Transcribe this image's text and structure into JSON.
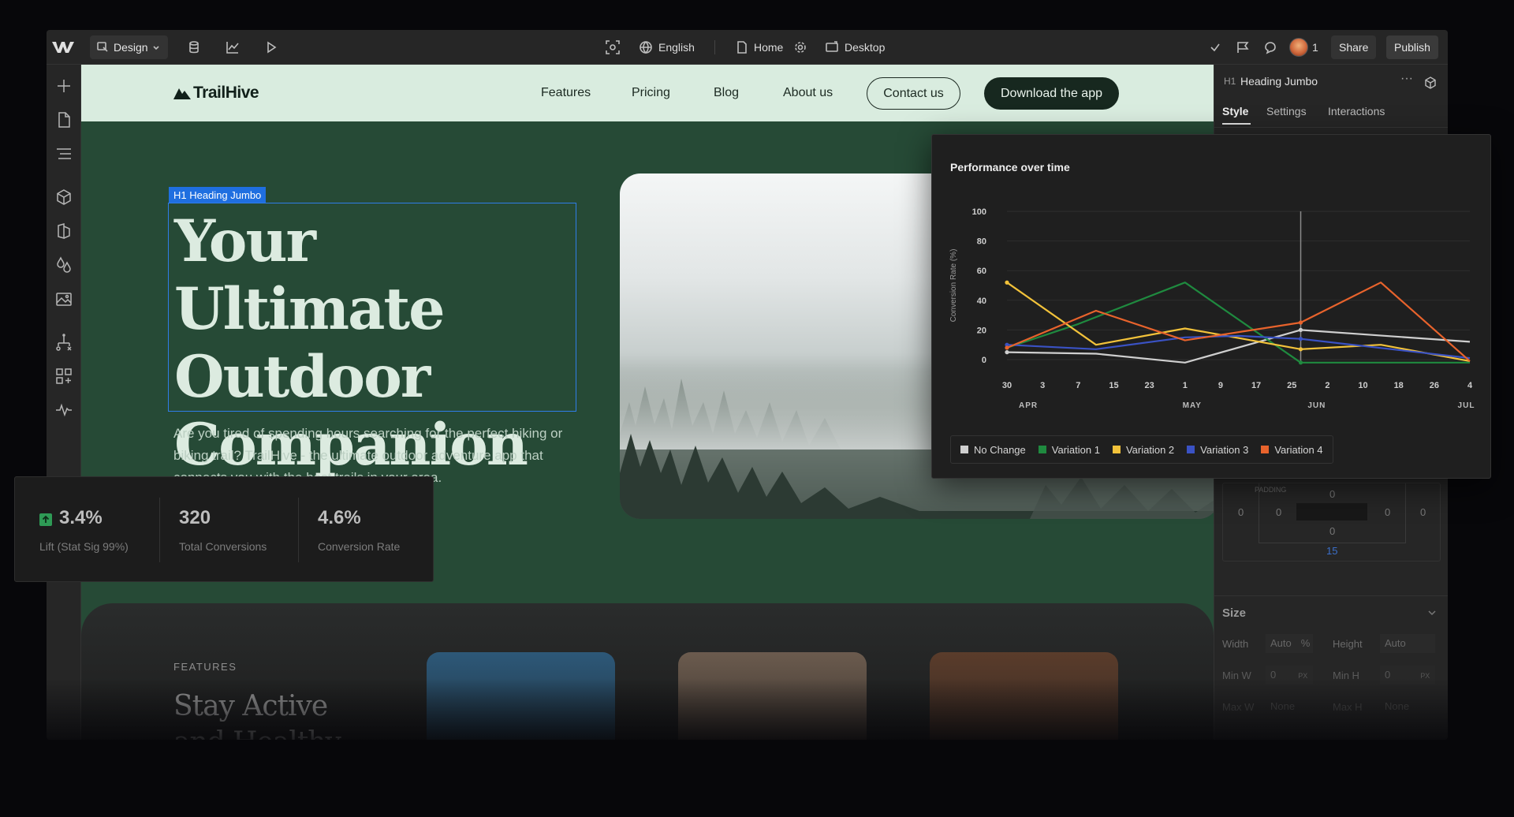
{
  "topbar": {
    "mode_label": "Design",
    "locale_label": "English",
    "page_label": "Home",
    "breakpoint_label": "Desktop",
    "collaborators_count": "1",
    "share_label": "Share",
    "publish_label": "Publish"
  },
  "site": {
    "brand": "TrailHive",
    "nav": [
      "Features",
      "Pricing",
      "Blog",
      "About us"
    ],
    "contact_label": "Contact us",
    "download_label": "Download the app",
    "selection_tag": "H1  Heading Jumbo",
    "hero_lines": [
      "Your Ultimate",
      "Outdoor",
      "Companion"
    ],
    "hero_body": "Are you tired of spending hours searching for the perfect hiking or biking trail? TrailHive - the ultimate outdoor adventure app that connects you with the best trails in your area.",
    "features_eyebrow": "FEATURES",
    "features_heading_1": "Stay Active",
    "features_heading_2": "and Healthy"
  },
  "panel": {
    "element_tag": "H1",
    "element_name": "Heading Jumbo",
    "tabs": [
      "Style",
      "Settings",
      "Interactions"
    ],
    "size_title": "Size",
    "width_label": "Width",
    "width_value": "Auto",
    "width_unit": "%",
    "height_label": "Height",
    "height_value": "Auto",
    "minw_label": "Min W",
    "minw_value": "0",
    "minw_unit": "PX",
    "minh_label": "Min H",
    "minh_value": "0",
    "minh_unit": "PX",
    "maxw_label": "Max W",
    "maxw_value": "None",
    "maxh_label": "Max H",
    "maxh_value": "None",
    "padding_label": "PADDING",
    "spacing_values": [
      "0",
      "0",
      "0",
      "0",
      "0",
      "0",
      "0"
    ],
    "spacing_highlight": "15"
  },
  "stats": [
    {
      "value": "3.4%",
      "label": "Lift (Stat Sig 99%)"
    },
    {
      "value": "320",
      "label": "Total Conversions"
    },
    {
      "value": "4.6%",
      "label": "Conversion Rate"
    }
  ],
  "colors": {
    "accent_blue": "#1f6fe0",
    "no_change": "#cfcfcf",
    "variation_1": "#1f8a3f",
    "variation_2": "#f2c23a",
    "variation_3": "#3a52c4",
    "variation_4": "#e8632c",
    "lift_up": "#2e9a55"
  },
  "chart_data": {
    "type": "line",
    "title": "Performance over time",
    "xlabel": "",
    "ylabel": "Conversion Rate (%)",
    "ylim": [
      0,
      100
    ],
    "yticks": [
      0,
      20,
      40,
      60,
      80,
      100
    ],
    "x": [
      "30",
      "3",
      "7",
      "15",
      "23",
      "1",
      "9",
      "17",
      "25",
      "2",
      "10",
      "18",
      "26",
      "4"
    ],
    "month_labels": [
      {
        "label": "APR",
        "at_index": 0.6
      },
      {
        "label": "MAY",
        "at_index": 5.2
      },
      {
        "label": "JUN",
        "at_index": 8.7
      },
      {
        "label": "JUL",
        "at_index": 12.9
      }
    ],
    "marker_index": 8.25,
    "grid": true,
    "legend": "bottom-left",
    "series": [
      {
        "name": "No Change",
        "color": "#cfcfcf",
        "values": [
          [
            0,
            5
          ],
          [
            2.5,
            4
          ],
          [
            5,
            -2
          ],
          [
            8.25,
            20
          ],
          [
            13,
            12
          ]
        ]
      },
      {
        "name": "Variation 1",
        "color": "#1f8a3f",
        "values": [
          [
            0,
            8
          ],
          [
            2,
            24
          ],
          [
            5,
            52
          ],
          [
            8.25,
            -2
          ],
          [
            13,
            -2
          ]
        ]
      },
      {
        "name": "Variation 2",
        "color": "#f2c23a",
        "values": [
          [
            0,
            52
          ],
          [
            2.5,
            10
          ],
          [
            5,
            21
          ],
          [
            8.25,
            7
          ],
          [
            10.5,
            10
          ],
          [
            13,
            -1
          ]
        ]
      },
      {
        "name": "Variation 3",
        "color": "#3a52c4",
        "values": [
          [
            0,
            10
          ],
          [
            2.5,
            7
          ],
          [
            5,
            15
          ],
          [
            6.5,
            16
          ],
          [
            8.25,
            14
          ],
          [
            13,
            1
          ]
        ]
      },
      {
        "name": "Variation 4",
        "color": "#e8632c",
        "values": [
          [
            0,
            8
          ],
          [
            2.5,
            33
          ],
          [
            5,
            13
          ],
          [
            8.25,
            25
          ],
          [
            10.5,
            52
          ],
          [
            13,
            -1
          ]
        ]
      }
    ]
  }
}
